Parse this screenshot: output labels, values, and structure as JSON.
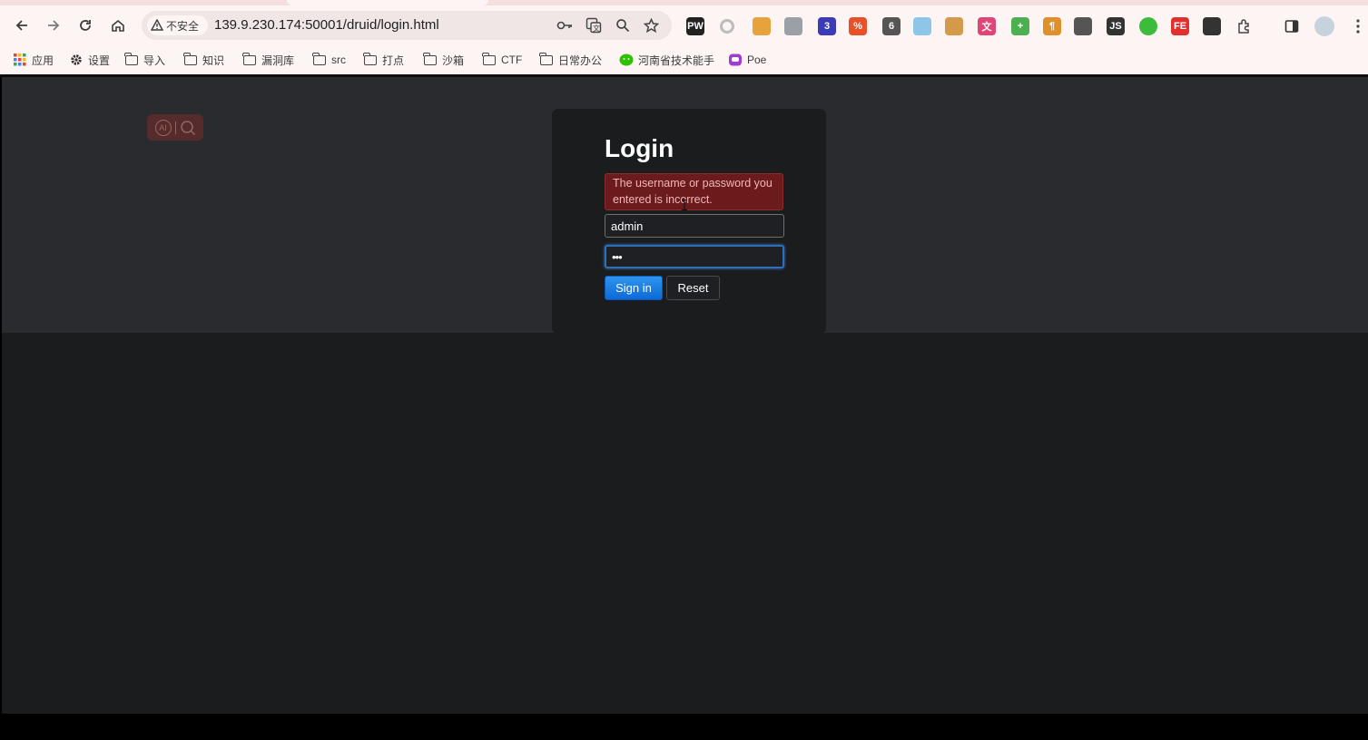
{
  "browser": {
    "security_label": "不安全",
    "url": "139.9.230.174:50001/druid/login.html",
    "nav": {
      "back_icon": "arrow-left-icon",
      "forward_icon": "arrow-right-icon",
      "reload_icon": "reload-icon",
      "home_icon": "home-icon"
    },
    "extensions": [
      {
        "name": "pwdown",
        "label": "PW",
        "color": "#222222"
      },
      {
        "name": "circle",
        "label": "",
        "color": "#bdbdbd"
      },
      {
        "name": "puzzle-orange",
        "label": "",
        "color": "#e8a23c"
      },
      {
        "name": "link",
        "label": "",
        "color": "#9aa0a6"
      },
      {
        "name": "shield-3",
        "label": "3",
        "color": "#3b3bb8"
      },
      {
        "name": "percent",
        "label": "%",
        "color": "#e8502a"
      },
      {
        "name": "s6",
        "label": "6",
        "color": "#555555"
      },
      {
        "name": "cup",
        "label": "",
        "color": "#8ec6ea"
      },
      {
        "name": "cookie",
        "label": "",
        "color": "#d49a4a"
      },
      {
        "name": "translate-x",
        "label": "文",
        "color": "#e0457a"
      },
      {
        "name": "plus-green",
        "label": "+",
        "color": "#4caf50"
      },
      {
        "name": "paragraph",
        "label": "¶",
        "color": "#e0902a"
      },
      {
        "name": "ufo",
        "label": "",
        "color": "#555555"
      },
      {
        "name": "js",
        "label": "JS",
        "color": "#333333"
      },
      {
        "name": "green-dot",
        "label": "",
        "color": "#3dbb3d"
      },
      {
        "name": "fe",
        "label": "FE",
        "color": "#e03030"
      },
      {
        "name": "spy",
        "label": "",
        "color": "#333333"
      }
    ]
  },
  "bookmarks": [
    {
      "name": "apps",
      "label": "应用",
      "icon": "grid-icon"
    },
    {
      "name": "settings",
      "label": "设置",
      "icon": "gear-icon"
    },
    {
      "name": "import",
      "label": "导入",
      "icon": "folder-icon"
    },
    {
      "name": "knowledge",
      "label": "知识",
      "icon": "folder-icon"
    },
    {
      "name": "vuln-lib",
      "label": "漏洞库",
      "icon": "folder-icon"
    },
    {
      "name": "src",
      "label": "src",
      "icon": "folder-icon"
    },
    {
      "name": "punch",
      "label": "打点",
      "icon": "folder-icon"
    },
    {
      "name": "sandbox",
      "label": "沙箱",
      "icon": "folder-icon"
    },
    {
      "name": "ctf",
      "label": "CTF",
      "icon": "folder-icon"
    },
    {
      "name": "office",
      "label": "日常办公",
      "icon": "folder-icon"
    },
    {
      "name": "henan-assistant",
      "label": "河南省技术能手",
      "icon": "wechat-icon"
    },
    {
      "name": "poe",
      "label": "Poe",
      "icon": "poe-icon"
    }
  ],
  "login": {
    "title": "Login",
    "error": "The username or password you entered is incorrect.",
    "username_value": "admin",
    "password_mask": "•••",
    "signin_label": "Sign in",
    "reset_label": "Reset"
  },
  "widget": {
    "ai_label": "AI"
  }
}
